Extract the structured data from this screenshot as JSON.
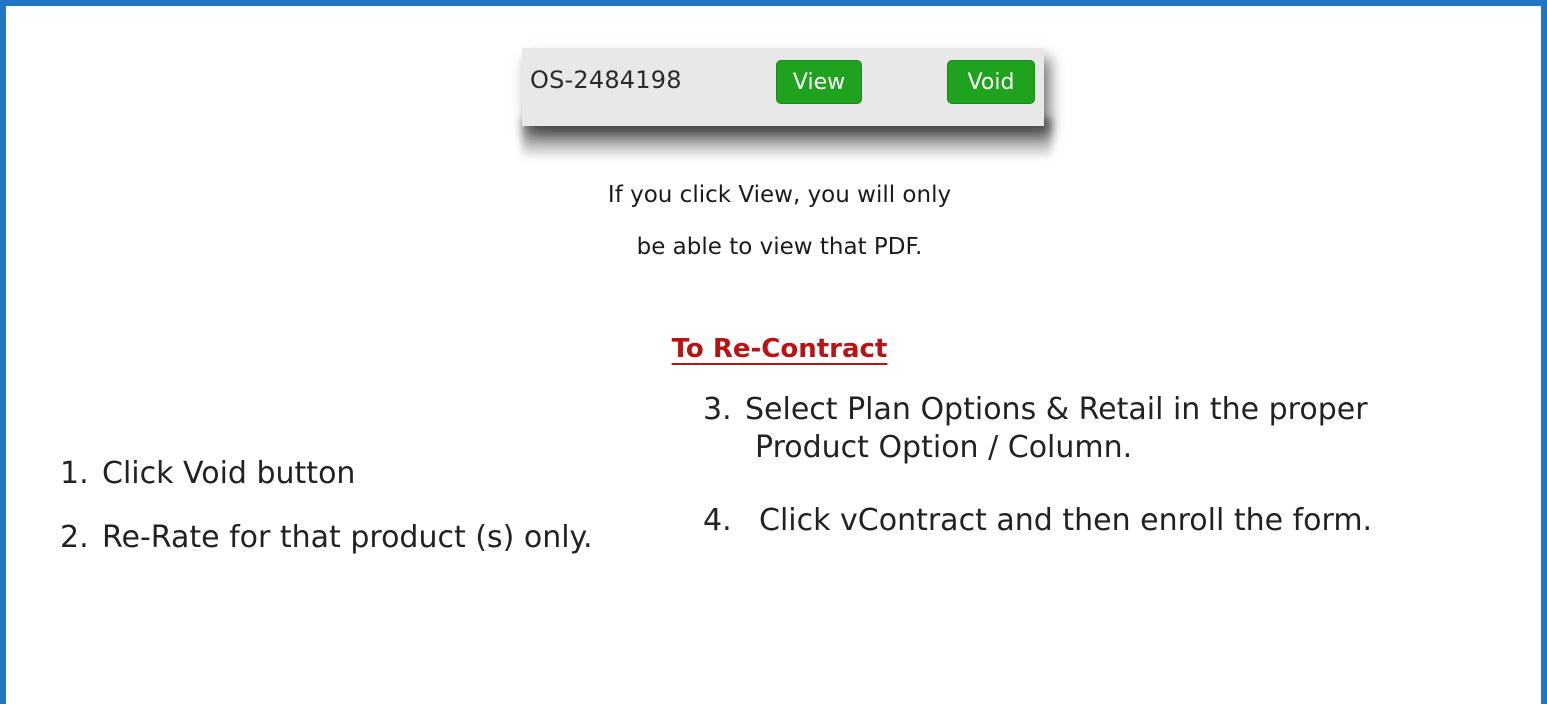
{
  "screenshot": {
    "order_id": "OS-2484198",
    "view_button": "View",
    "void_button": "Void",
    "button_color": "#1fa31f"
  },
  "caption": {
    "line1": "If you click View, you will only",
    "line2": "be able to view that PDF."
  },
  "heading": "To Re-Contract",
  "heading_color": "#b81414",
  "border_color": "#1f77c4",
  "steps_left": [
    {
      "number": "1.",
      "text": "Click Void button"
    },
    {
      "number": "2.",
      "text": "Re-Rate for that product (s) only."
    }
  ],
  "steps_right": [
    {
      "number": "3.",
      "text_line1": "Select Plan Options & Retail in the proper",
      "text_line2": "Product Option /  Column."
    },
    {
      "number": "4.",
      "text": "Click vContract and then enroll the form."
    }
  ]
}
